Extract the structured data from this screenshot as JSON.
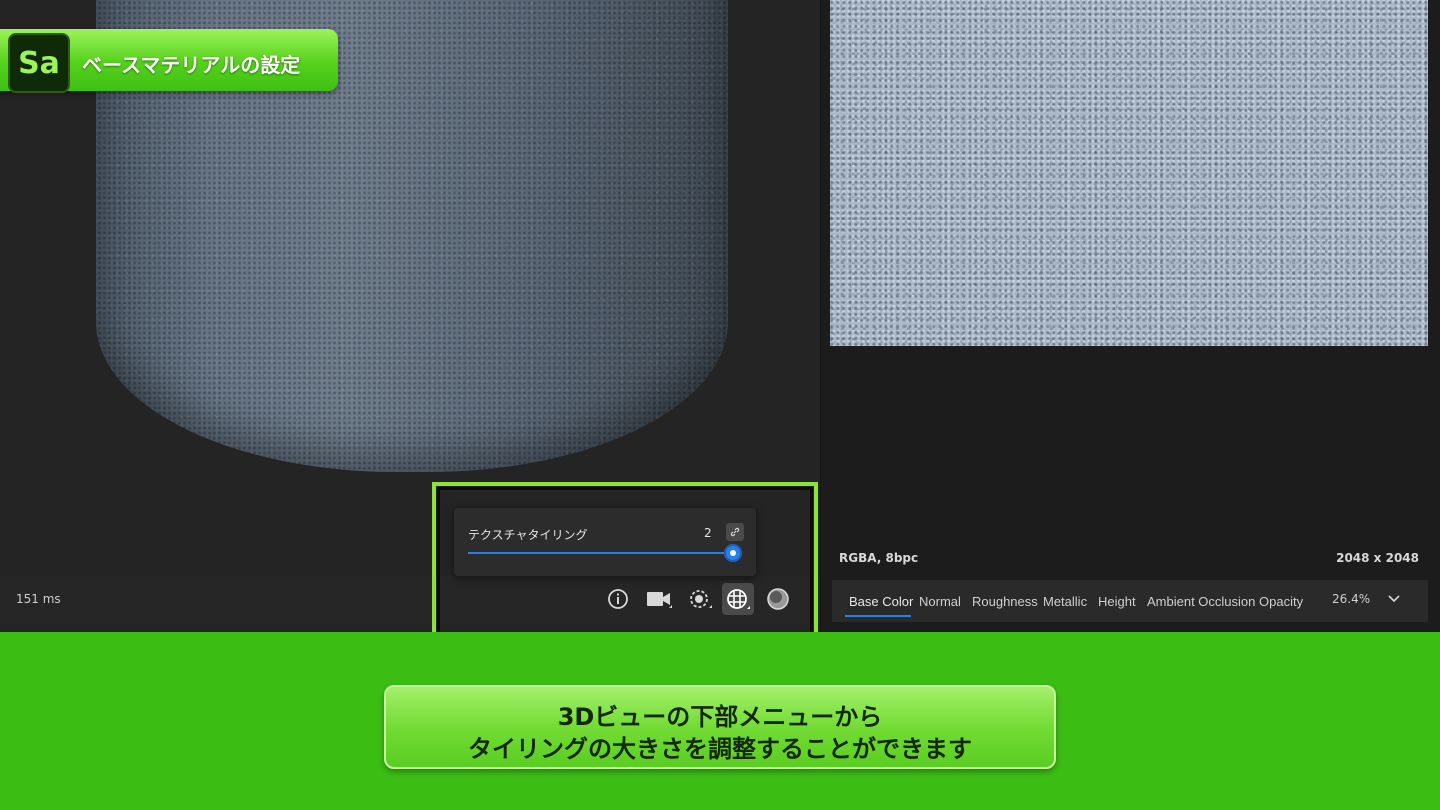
{
  "title_badge": {
    "logo": "Sa",
    "title": "ベースマテリアルの設定"
  },
  "viewport": {
    "render_time": "151 ms",
    "tiling_popover": {
      "label": "テクスチャタイリング",
      "value": "2",
      "link_icon": "link-icon"
    },
    "toolbar": [
      {
        "name": "info-button",
        "icon": "info-icon",
        "active": false
      },
      {
        "name": "camera-button",
        "icon": "video-camera-icon",
        "active": false
      },
      {
        "name": "environment-button",
        "icon": "environment-light-icon",
        "active": false
      },
      {
        "name": "tiling-button",
        "icon": "tiling-grid-icon",
        "active": true
      },
      {
        "name": "material-ball-button",
        "icon": "material-ball-icon",
        "active": false
      }
    ]
  },
  "texture_panel": {
    "format": "RGBA, 8bpc",
    "size": "2048 x 2048",
    "channels": [
      "Base Color",
      "Normal",
      "Roughness",
      "Metallic",
      "Height",
      "Ambient Occlusion",
      "Opacity"
    ],
    "active_channel": "Base Color",
    "zoom": "26.4%"
  },
  "caption": {
    "line1": "3Dビューの下部メニューから",
    "line2": "タイリングの大きさを調整することができます"
  },
  "colors": {
    "accent_blue": "#2680eb",
    "highlight_green": "#8ee03c",
    "band_green": "#3bbd14"
  }
}
